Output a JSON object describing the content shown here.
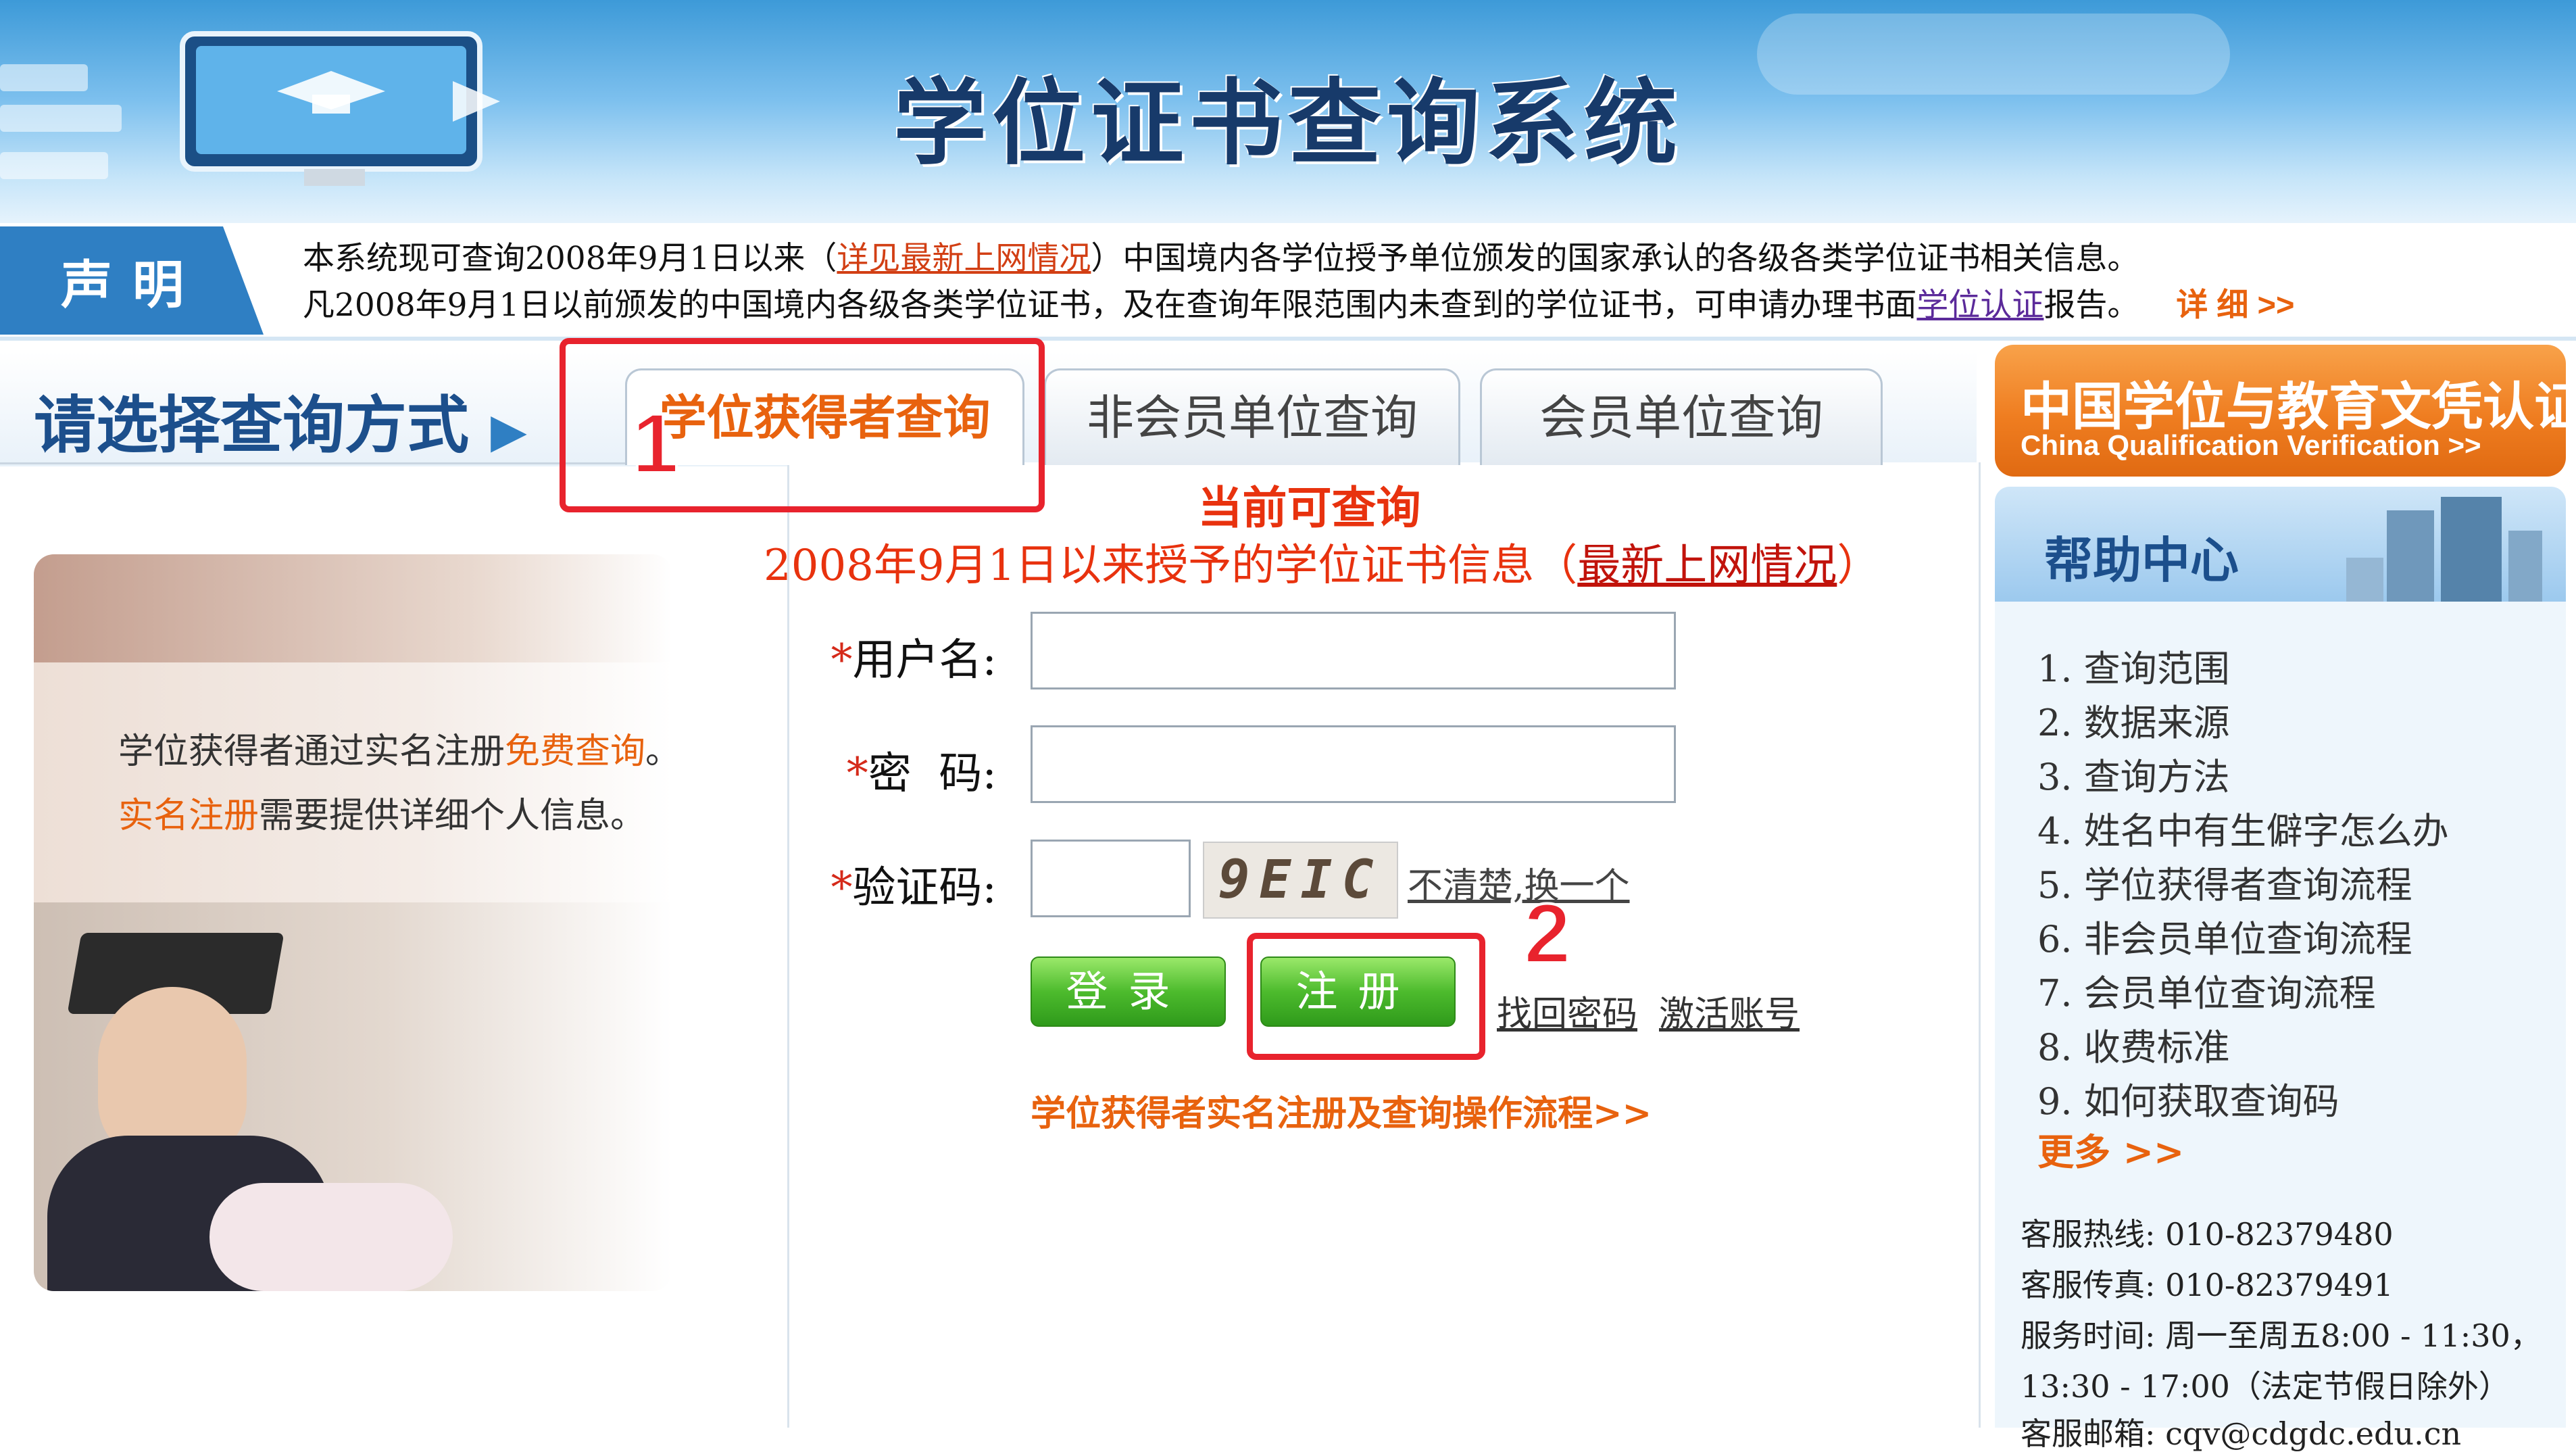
{
  "header": {
    "title": "学位证书查询系统"
  },
  "notice": {
    "tab_label": "声明",
    "line1_pre": "本系统现可查询2008年9月1日以来（",
    "line1_link": "详见最新上网情况",
    "line1_post": "）中国境内各学位授予单位颁发的国家承认的各级各类学位证书相关信息。",
    "line2_pre": "凡2008年9月1日以前颁发的中国境内各级各类学位证书，及在查询年限范围内未查到的学位证书，可申请办理书面",
    "line2_link": "学位认证",
    "line2_post": "报告。",
    "details": "详 细 >>"
  },
  "query": {
    "select_method": "请选择查询方式",
    "tabs": [
      "学位获得者查询",
      "非会员单位查询",
      "会员单位查询"
    ],
    "current_query": "当前可查询",
    "info_pre": "2008年9月1日以来授予的学位证书信息（",
    "info_link": "最新上网情况",
    "info_post": "）"
  },
  "left_card": {
    "line1_pre": "学位获得者通过实名注册",
    "line1_accent": "免费查询",
    "line1_post": "。",
    "line2_accent": "实名注册",
    "line2_post": "需要提供详细个人信息。"
  },
  "form": {
    "required_mark": "*",
    "username_label": "用户名:",
    "password_label": "密  码:",
    "captcha_label": "验证码:",
    "captcha_text": "9EIC",
    "captcha_refresh": "不清楚,换一个",
    "login_button": "登录",
    "register_button": "注册",
    "forgot_password": "找回密码",
    "activate_account": "激活账号",
    "flow_link": "学位获得者实名注册及查询操作流程>>"
  },
  "annotations": {
    "marker1": "1",
    "marker2": "2"
  },
  "sidebar": {
    "cqv_title": "中国学位与教育文凭认证",
    "cqv_subtitle": "China Qualification Verification >>",
    "help_title": "帮助中心",
    "help_items": [
      "1. 查询范围",
      "2. 数据来源",
      "3. 查询方法",
      "4. 姓名中有生僻字怎么办",
      "5. 学位获得者查询流程",
      "6. 非会员单位查询流程",
      "7. 会员单位查询流程",
      "8. 收费标准",
      "9. 如何获取查询码"
    ],
    "help_more": "更多 >>",
    "hotline": "客服热线:  010-82379480",
    "fax": "客服传真:  010-82379491",
    "hours": "服务时间:  周一至周五8:00 - 11:30，",
    "hours2": "13:30 - 17:00（法定节假日除外）",
    "email": "客服邮箱:  cqv@cdgdc.edu.cn"
  }
}
